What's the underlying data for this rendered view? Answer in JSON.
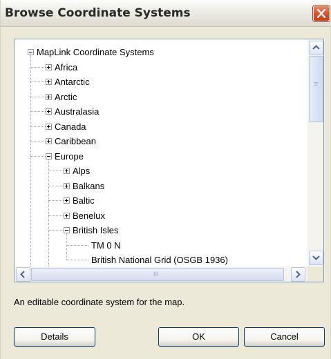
{
  "window": {
    "title": "Browse Coordinate Systems"
  },
  "tree": {
    "items": [
      {
        "label": "MapLink Coordinate Systems",
        "expander": "minus"
      },
      {
        "label": "Africa",
        "expander": "plus"
      },
      {
        "label": "Antarctic",
        "expander": "plus"
      },
      {
        "label": "Arctic",
        "expander": "plus"
      },
      {
        "label": "Australasia",
        "expander": "plus"
      },
      {
        "label": "Canada",
        "expander": "plus"
      },
      {
        "label": "Caribbean",
        "expander": "plus"
      },
      {
        "label": "Europe",
        "expander": "minus"
      },
      {
        "label": "Alps",
        "expander": "plus"
      },
      {
        "label": "Balkans",
        "expander": "plus"
      },
      {
        "label": "Baltic",
        "expander": "plus"
      },
      {
        "label": "Benelux",
        "expander": "plus"
      },
      {
        "label": "British Isles",
        "expander": "minus"
      },
      {
        "label": "TM 0 N",
        "expander": "none"
      },
      {
        "label": "British National Grid (OSGB 1936)",
        "expander": "none"
      }
    ]
  },
  "status_text": "An editable coordinate system for the map.",
  "buttons": {
    "details": "Details",
    "ok": "OK",
    "cancel": "Cancel"
  },
  "scrollbar": {
    "h_grip": "III",
    "v_grip": "≡"
  }
}
